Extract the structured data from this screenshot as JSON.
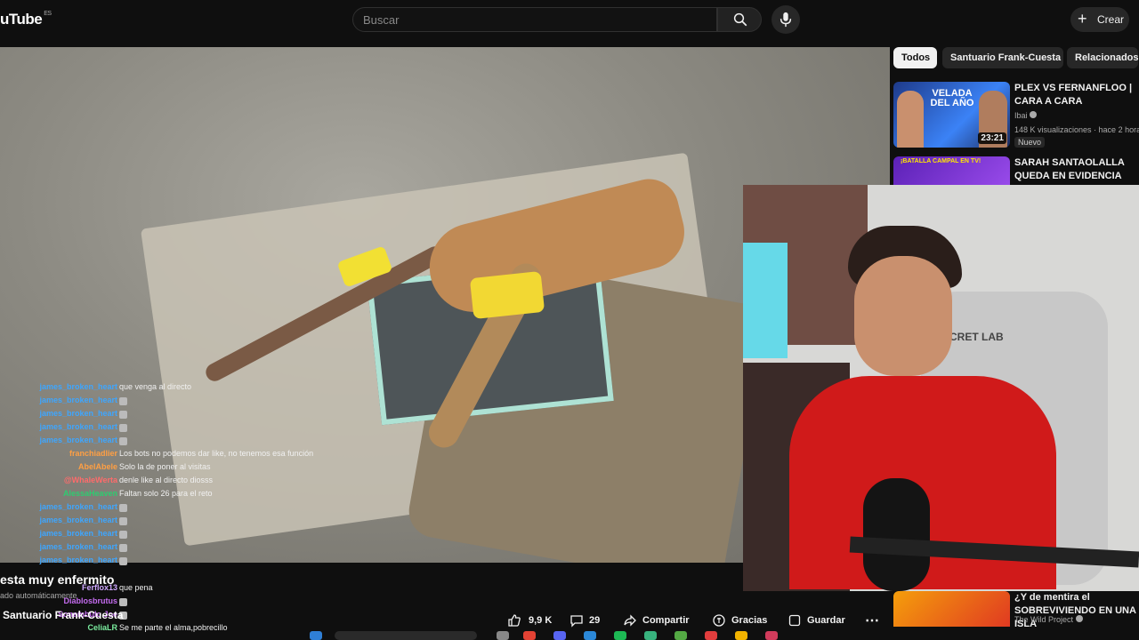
{
  "topbar": {
    "logo": "uTube",
    "logo_country": "ES",
    "search_placeholder": "Buscar",
    "create_label": "Crear"
  },
  "chips": [
    "Todos",
    "Santuario Frank-Cuesta",
    "Relacionados"
  ],
  "recommendations": [
    {
      "title": "PLEX VS FERNANFLOO | CARA A CARA",
      "channel": "Ibai",
      "meta": "148 K visualizaciones · hace 2 horas",
      "duration": "23:21",
      "badge": "Nuevo",
      "thumb_text": "VELADA DEL AÑO"
    },
    {
      "title": "SARAH SANTAOLALLA QUEDA EN EVIDENCIA TRAS ...",
      "thumb_text": "¡BATALLA CAMPAL EN TV!"
    },
    {
      "title": "¿Y de mentira el SOBREVIVIENDO EN UNA ISLA",
      "channel": "The Wild Project"
    }
  ],
  "chat": [
    {
      "user": "james_broken_heart",
      "text": "que venga al directo",
      "color": "#3ea6ff"
    },
    {
      "user": "james_broken_heart",
      "text": "",
      "color": "#3ea6ff"
    },
    {
      "user": "james_broken_heart",
      "text": "",
      "color": "#3ea6ff"
    },
    {
      "user": "james_broken_heart",
      "text": "",
      "color": "#3ea6ff"
    },
    {
      "user": "james_broken_heart",
      "text": "",
      "color": "#3ea6ff"
    },
    {
      "user": "franchiadlier",
      "text": "Los bots no podemos dar like, no tenemos esa función",
      "color": "#ff9f43"
    },
    {
      "user": "AbelAbele",
      "text": "Solo la de poner al visitas",
      "color": "#ff9f43"
    },
    {
      "user": "@WhaleWerta",
      "text": "denle like al directo diosss",
      "color": "#ff6b6b"
    },
    {
      "user": "AlessaHeaven",
      "text": "Faltan solo 26 para el reto",
      "color": "#2ecc71"
    },
    {
      "user": "james_broken_heart",
      "text": "",
      "color": "#3ea6ff"
    },
    {
      "user": "james_broken_heart",
      "text": "",
      "color": "#3ea6ff"
    },
    {
      "user": "james_broken_heart",
      "text": "",
      "color": "#3ea6ff"
    },
    {
      "user": "james_broken_heart",
      "text": "",
      "color": "#3ea6ff"
    },
    {
      "user": "james_broken_heart",
      "text": "",
      "color": "#3ea6ff"
    },
    {
      "user": "Ferflox13",
      "text": "que pena",
      "color": "#cfa8ff"
    },
    {
      "user": "Diablosbrutus",
      "text": "",
      "color": "#c56cf0"
    },
    {
      "user": "Sonambulo Joe",
      "text": "",
      "color": "#c56cf0"
    },
    {
      "user": "CeliaLR",
      "text": "Se me parte el alma,pobrecillo",
      "color": "#7bed9f"
    }
  ],
  "video": {
    "title": "esta muy enfermito",
    "subtitle": "ado automáticamente",
    "channel": "Santuario Frank-Cuesta"
  },
  "webcam_overlay": {
    "brand": "CRET LAB"
  },
  "actions": {
    "likes": "9,9 K",
    "comments": "29",
    "share": "Compartir",
    "thanks": "Gracias",
    "save": "Guardar"
  }
}
